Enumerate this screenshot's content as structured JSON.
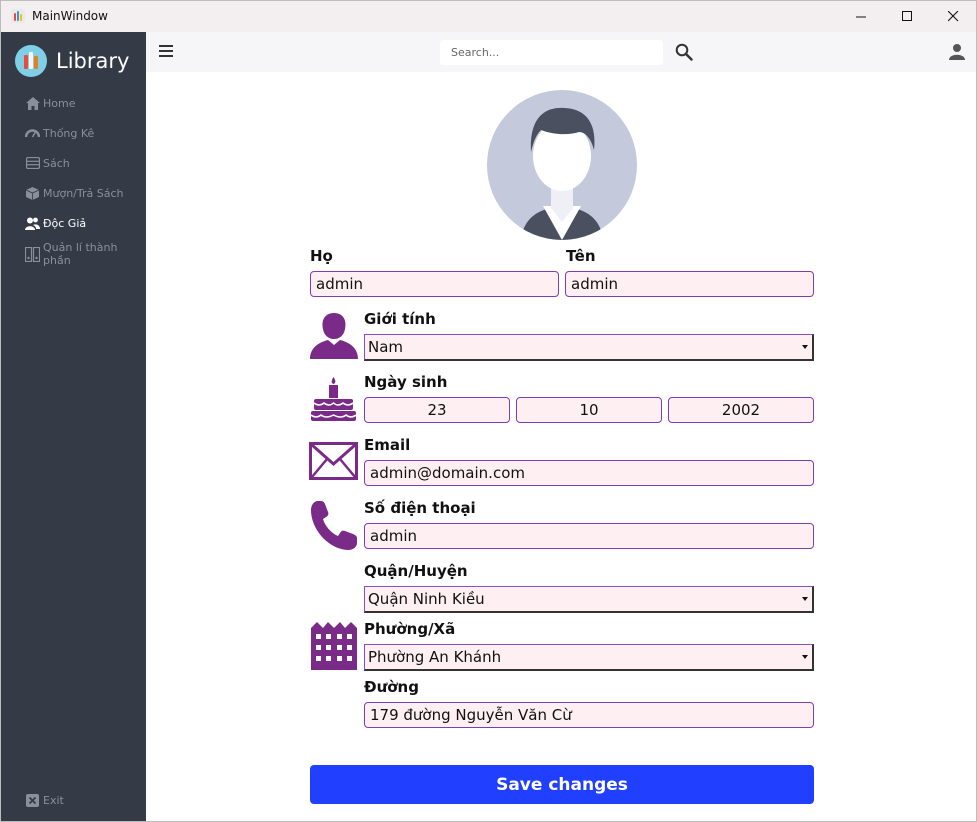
{
  "window": {
    "title": "MainWindow"
  },
  "sidebar": {
    "brand": "Library",
    "items": [
      {
        "label": "Home",
        "icon": "home-icon"
      },
      {
        "label": "Thống Kê",
        "icon": "gauge-icon"
      },
      {
        "label": "Sách",
        "icon": "book-list-icon"
      },
      {
        "label": "Mượn/Trả Sách",
        "icon": "box-icon"
      },
      {
        "label": "Độc Giả",
        "icon": "users-icon",
        "active": true
      },
      {
        "label": "Quản lí thành phần",
        "icon": "binders-icon"
      }
    ],
    "exit_label": "Exit"
  },
  "topbar": {
    "search_placeholder": "Search..."
  },
  "form": {
    "ho_label": "Họ",
    "ho_value": "admin",
    "ten_label": "Tên",
    "ten_value": "admin",
    "gender_label": "Giới tính",
    "gender_value": "Nam",
    "dob_label": "Ngày sinh",
    "dob_day": "23",
    "dob_month": "10",
    "dob_year": "2002",
    "email_label": "Email",
    "email_value": "admin@domain.com",
    "phone_label": "Số điện thoại",
    "phone_value": "admin",
    "district_label": "Quận/Huyện",
    "district_value": "Quận Ninh Kiều",
    "ward_label": "Phường/Xã",
    "ward_value": "Phường An Khánh",
    "street_label": "Đường",
    "street_value": "179 đường Nguyễn Văn Cừ",
    "save_label": "Save changes"
  },
  "colors": {
    "sidebar_bg": "#343a46",
    "accent_purple": "#7a2a87",
    "field_border": "#7b3fb3",
    "field_bg": "#fef0f2",
    "save_button": "#213fff"
  }
}
